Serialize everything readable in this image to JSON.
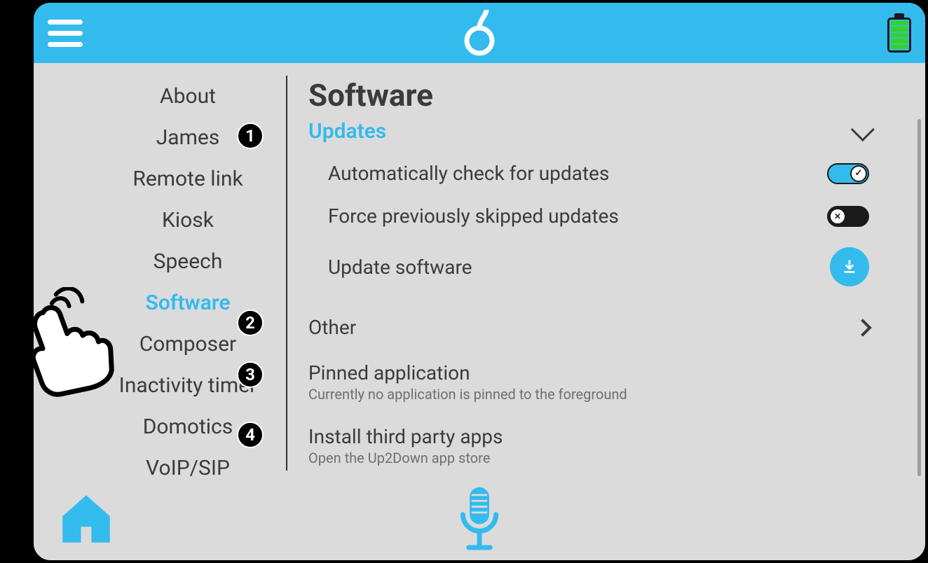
{
  "colors": {
    "accent": "#33BBEE",
    "text": "#3B3B3B"
  },
  "sidebar": {
    "items": [
      {
        "label": "About"
      },
      {
        "label": "James"
      },
      {
        "label": "Remote link"
      },
      {
        "label": "Kiosk"
      },
      {
        "label": "Speech"
      },
      {
        "label": "Software",
        "active": true
      },
      {
        "label": "Composer"
      },
      {
        "label": "Inactivity timer"
      },
      {
        "label": "Domotics"
      },
      {
        "label": "VoIP/SIP"
      }
    ]
  },
  "main": {
    "title": "Software",
    "updates_section_label": "Updates",
    "auto_check_label": "Automatically check for updates",
    "auto_check_on": true,
    "force_skipped_label": "Force previously skipped updates",
    "force_skipped_on": false,
    "update_now_label": "Update software",
    "other_label": "Other",
    "pinned_title": "Pinned application",
    "pinned_sub": "Currently no application is pinned to the foreground",
    "install_title": "Install third party apps",
    "install_sub": "Open the Up2Down app store"
  },
  "annotations": [
    "1",
    "2",
    "3",
    "4"
  ]
}
